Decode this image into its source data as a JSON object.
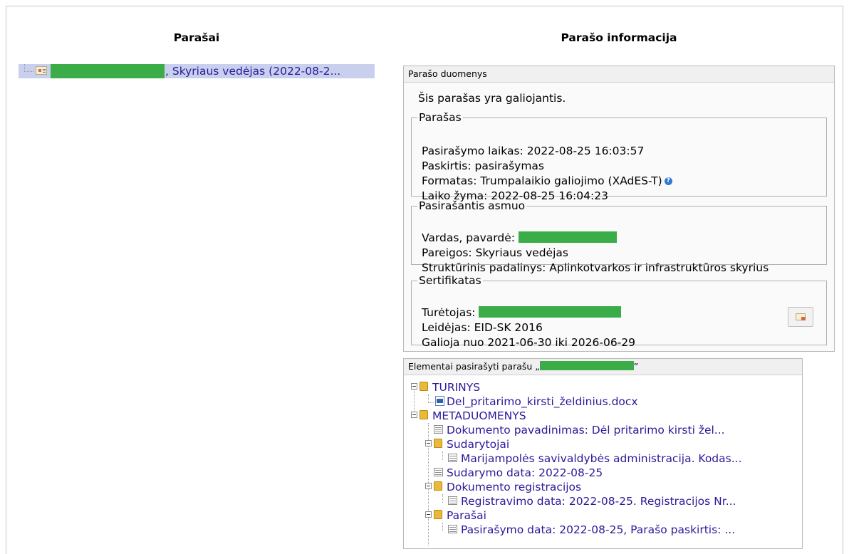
{
  "left": {
    "title": "Parašai",
    "signature_item": ", Skyriaus vedėjas (2022-08-2..."
  },
  "right": {
    "title": "Parašo informacija",
    "panel_header": "Parašo duomenys",
    "valid_text": "Šis parašas yra galiojantis.",
    "signature": {
      "legend": "Parašas",
      "signing_time": "Pasirašymo laikas: 2022-08-25 16:03:57",
      "purpose": "Paskirtis: pasirašymas",
      "format": "Formatas: Trumpalaikio galiojimo (XAdES-T)",
      "timestamp": "Laiko žyma: 2022-08-25 16:04:23"
    },
    "signer": {
      "legend": "Pasirašantis asmuo",
      "name_label": "Vardas, pavardė:",
      "position": "Pareigos: Skyriaus vedėjas",
      "unit": "Struktūrinis padalinys: Aplinkotvarkos ir infrastruktūros skyrius"
    },
    "certificate": {
      "legend": "Sertifikatas",
      "holder_label": "Turėtojas:",
      "issuer": "Leidėjas: EID-SK 2016",
      "validity": "Galioja nuo 2021-06-30 iki 2026-06-29"
    }
  },
  "elements": {
    "header_prefix": "Elementai pasirašyti parašu „",
    "header_suffix": "”",
    "tree": [
      "TURINYS",
      "Del_pritarimo_kirsti_želdinius.docx",
      "METADUOMENYS",
      "Dokumento pavadinimas: Dėl pritarimo kirsti žel...",
      "Sudarytojai",
      "Marijampolės savivaldybės administracija. Kodas...",
      "Sudarymo data: 2022-08-25",
      "Dokumento registracijos",
      "Registravimo data: 2022-08-25. Registracijos Nr...",
      "Parašai",
      "Pasirašymo data: 2022-08-25, Parašo paskirtis: ..."
    ]
  },
  "icons": {
    "signature": "signature-card-icon",
    "help": "help-icon",
    "certificate": "certificate-icon",
    "folder": "folder-icon",
    "document": "word-document-icon",
    "table": "table-icon"
  },
  "colors": {
    "link": "#2b1a99",
    "selection": "#c8d0ee",
    "redaction": "#3aad49"
  }
}
